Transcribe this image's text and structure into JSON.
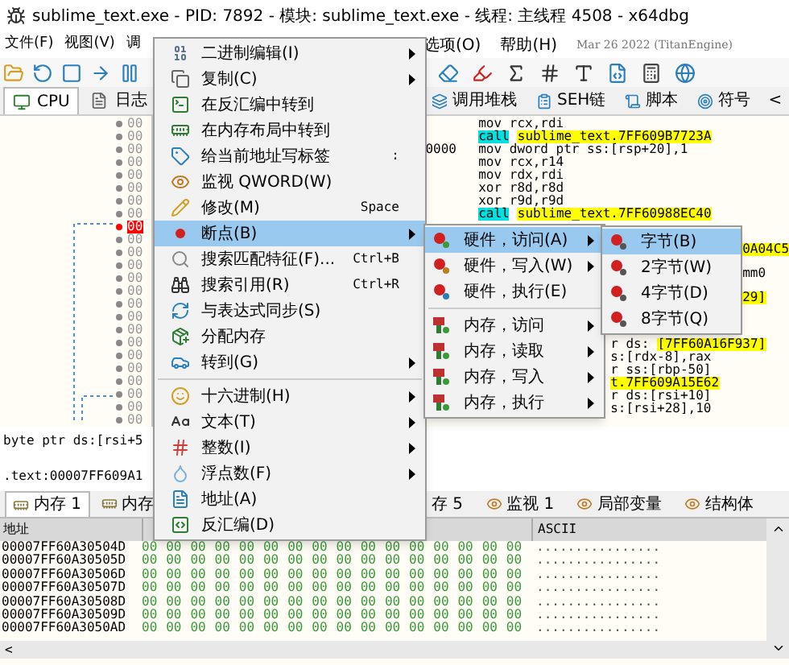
{
  "window": {
    "title": "sublime_text.exe - PID: 7892 - 模块: sublime_text.exe - 线程: 主线程 4508 - x64dbg"
  },
  "menu_bar": {
    "items_left": [
      "文件(F)",
      "视图(V)",
      "调"
    ],
    "items_right": [
      "选项(O)",
      "帮助(H)"
    ],
    "build": "Mar 26 2022 (TitanEngine)"
  },
  "tabs_left": [
    {
      "label": "CPU",
      "selected": true
    },
    {
      "label": "日志",
      "selected": false
    }
  ],
  "tabs_right": [
    {
      "label": "调用堆栈",
      "selected": false
    },
    {
      "label": "SEH链",
      "selected": false
    },
    {
      "label": "脚本",
      "selected": false
    },
    {
      "label": "符号",
      "selected": false
    }
  ],
  "tabs_scroll": "<",
  "disassembly": {
    "rows": [
      {
        "address": "00",
        "breakpoint": false
      },
      {
        "address": "00",
        "breakpoint": false
      },
      {
        "address": "00",
        "breakpoint": false
      },
      {
        "address": "00",
        "breakpoint": false
      },
      {
        "address": "00",
        "breakpoint": false
      },
      {
        "address": "00",
        "breakpoint": false
      },
      {
        "address": "00",
        "breakpoint": false
      },
      {
        "address": "00",
        "breakpoint": false
      },
      {
        "address": "00",
        "breakpoint": true
      },
      {
        "address": "00",
        "breakpoint": false
      },
      {
        "address": "00",
        "breakpoint": false
      },
      {
        "address": "00",
        "breakpoint": false
      },
      {
        "address": "00",
        "breakpoint": false
      },
      {
        "address": "00",
        "breakpoint": false
      },
      {
        "address": "00",
        "breakpoint": false
      },
      {
        "address": "00",
        "breakpoint": false
      },
      {
        "address": "00",
        "breakpoint": false
      },
      {
        "address": "00",
        "breakpoint": false
      },
      {
        "address": "00",
        "breakpoint": false
      },
      {
        "address": "00",
        "breakpoint": false
      },
      {
        "address": "00",
        "breakpoint": false
      },
      {
        "address": "00",
        "breakpoint": false
      },
      {
        "address": "00",
        "breakpoint": false
      },
      {
        "address": "00",
        "breakpoint": false
      }
    ],
    "code_lines": [
      {
        "tokens": [
          {
            "text": "mov rcx,rdi",
            "kind": "plain"
          }
        ]
      },
      {
        "tokens": [
          {
            "text": "call",
            "kind": "call"
          },
          {
            "text": "sublime_text.7FF609B7723A",
            "kind": "label"
          }
        ]
      },
      {
        "bytes": "0000",
        "tokens": [
          {
            "text": "mov dword ptr ss:[rsp+20],1",
            "kind": "plain"
          }
        ]
      },
      {
        "tokens": [
          {
            "text": "mov rcx,r14",
            "kind": "plain"
          }
        ]
      },
      {
        "tokens": [
          {
            "text": "mov rdx,rdi",
            "kind": "plain"
          }
        ]
      },
      {
        "tokens": [
          {
            "text": "xor r8d,r8d",
            "kind": "plain"
          }
        ]
      },
      {
        "tokens": [
          {
            "text": "xor r9d,r9d",
            "kind": "plain"
          }
        ]
      },
      {
        "tokens": [
          {
            "text": "call",
            "kind": "call"
          },
          {
            "text": "sublime_text.7FF60988EC40",
            "kind": "label"
          }
        ]
      }
    ],
    "fragments_right": [
      [
        {
          "text": "0A04C5",
          "kind": "label"
        }
      ],
      [
        {
          "text": "mm0",
          "kind": "plain"
        }
      ],
      [
        {
          "text": "29]",
          "kind": "label"
        }
      ]
    ],
    "fragments_lower": [
      [
        {
          "text": "r ds:",
          "kind": "plain"
        },
        {
          "text": "[7FF60A16F937]",
          "kind": "label"
        }
      ],
      [
        {
          "text": "s:[rdx-8],rax",
          "kind": "plain"
        }
      ],
      [
        {
          "text": "r ss:[rbp-50]",
          "kind": "plain"
        }
      ],
      [
        {
          "text": "t.7FF609A15E62",
          "kind": "label"
        }
      ],
      [
        {
          "text": "r ds:[rsi+10]",
          "kind": "plain"
        }
      ],
      [
        {
          "text": "s:[rsi+28],10",
          "kind": "plain"
        }
      ]
    ]
  },
  "info_lines": [
    "byte ptr ds:[rsi+5",
    ".text:00007FF609A1"
  ],
  "bottom_tabs_left": [
    {
      "label": "内存 1",
      "selected": true
    },
    {
      "label": "内存",
      "selected": false
    }
  ],
  "bottom_tabs_right": [
    {
      "label": "存 5",
      "selected": false
    },
    {
      "label": "监视 1",
      "selected": false
    },
    {
      "label": "局部变量",
      "selected": false
    },
    {
      "label": "结构体",
      "selected": false
    }
  ],
  "dump": {
    "columns": [
      "地址",
      "ASCII"
    ],
    "rows": [
      {
        "address": "00007FF60A30504D",
        "hex": [
          "00",
          "00",
          "00",
          "00",
          "00",
          "00",
          "00",
          "00",
          "00",
          "00",
          "00",
          "00",
          "00",
          "00",
          "00",
          "00"
        ],
        "ascii": "................"
      },
      {
        "address": "00007FF60A30505D",
        "hex": [
          "00",
          "00",
          "00",
          "00",
          "00",
          "00",
          "00",
          "00",
          "00",
          "00",
          "00",
          "00",
          "00",
          "00",
          "00",
          "00"
        ],
        "ascii": "................"
      },
      {
        "address": "00007FF60A30506D",
        "hex": [
          "00",
          "00",
          "00",
          "00",
          "00",
          "00",
          "00",
          "00",
          "00",
          "00",
          "00",
          "00",
          "00",
          "00",
          "00",
          "00"
        ],
        "ascii": "................"
      },
      {
        "address": "00007FF60A30507D",
        "hex": [
          "00",
          "00",
          "00",
          "00",
          "00",
          "00",
          "00",
          "00",
          "00",
          "00",
          "00",
          "00",
          "00",
          "00",
          "00",
          "00"
        ],
        "ascii": "................"
      },
      {
        "address": "00007FF60A30508D",
        "hex": [
          "00",
          "00",
          "00",
          "00",
          "00",
          "00",
          "00",
          "00",
          "00",
          "00",
          "00",
          "00",
          "00",
          "00",
          "00",
          "00"
        ],
        "ascii": "................"
      },
      {
        "address": "00007FF60A30509D",
        "hex": [
          "00",
          "00",
          "00",
          "00",
          "00",
          "00",
          "00",
          "00",
          "00",
          "00",
          "00",
          "00",
          "00",
          "00",
          "00",
          "00"
        ],
        "ascii": "................"
      },
      {
        "address": "00007FF60A3050AD",
        "hex": [
          "00",
          "00",
          "00",
          "00",
          "00",
          "00",
          "00",
          "00",
          "00",
          "00",
          "00",
          "00",
          "00",
          "00",
          "00",
          "00"
        ],
        "ascii": "................"
      }
    ],
    "scroll_left": "<"
  },
  "context_menu": {
    "items": [
      {
        "label": "二进制编辑(I)",
        "submenu": true,
        "selected": false
      },
      {
        "label": "复制(C)",
        "submenu": true,
        "selected": false
      },
      {
        "label": "在反汇编中转到",
        "submenu": false,
        "selected": false
      },
      {
        "label": "在内存布局中转到",
        "submenu": false,
        "selected": false
      },
      {
        "label": "给当前地址写标签",
        "shortcut": ":",
        "submenu": false,
        "selected": false
      },
      {
        "label": "监视 QWORD(W)",
        "submenu": false,
        "selected": false
      },
      {
        "label": "修改(M)",
        "shortcut": "Space",
        "submenu": false,
        "selected": false
      },
      {
        "label": "断点(B)",
        "submenu": true,
        "selected": true
      },
      {
        "label": "搜索匹配特征(F)...",
        "shortcut": "Ctrl+B",
        "submenu": false,
        "selected": false
      },
      {
        "label": "搜索引用(R)",
        "shortcut": "Ctrl+R",
        "submenu": false,
        "selected": false
      },
      {
        "label": "与表达式同步(S)",
        "submenu": false,
        "selected": false
      },
      {
        "label": "分配内存",
        "submenu": false,
        "selected": false
      },
      {
        "label": "转到(G)",
        "submenu": true,
        "selected": false
      },
      {
        "label": "十六进制(H)",
        "submenu": true,
        "selected": false,
        "separator_before": true
      },
      {
        "label": "文本(T)",
        "submenu": true,
        "selected": false
      },
      {
        "label": "整数(I)",
        "submenu": true,
        "selected": false
      },
      {
        "label": "浮点数(F)",
        "submenu": true,
        "selected": false
      },
      {
        "label": "地址(A)",
        "submenu": false,
        "selected": false
      },
      {
        "label": "反汇编(D)",
        "submenu": false,
        "selected": false
      }
    ]
  },
  "breakpoint_menu": {
    "items": [
      {
        "label": "硬件，访问(A)",
        "submenu": true,
        "selected": true,
        "kind": "hardware"
      },
      {
        "label": "硬件，写入(W)",
        "submenu": true,
        "selected": false,
        "kind": "hardware"
      },
      {
        "label": "硬件，执行(E)",
        "submenu": false,
        "selected": false,
        "kind": "hardware"
      },
      {
        "label": "内存，访问",
        "submenu": true,
        "selected": false,
        "kind": "memory",
        "separator_before": true
      },
      {
        "label": "内存，读取",
        "submenu": true,
        "selected": false,
        "kind": "memory"
      },
      {
        "label": "内存，写入",
        "submenu": true,
        "selected": false,
        "kind": "memory"
      },
      {
        "label": "内存，执行",
        "submenu": true,
        "selected": false,
        "kind": "memory"
      }
    ]
  },
  "size_menu": {
    "items": [
      {
        "label": "字节(B)",
        "selected": true
      },
      {
        "label": "2字节(W)",
        "selected": false
      },
      {
        "label": "4字节(D)",
        "selected": false
      },
      {
        "label": "8字节(Q)",
        "selected": false
      }
    ]
  }
}
